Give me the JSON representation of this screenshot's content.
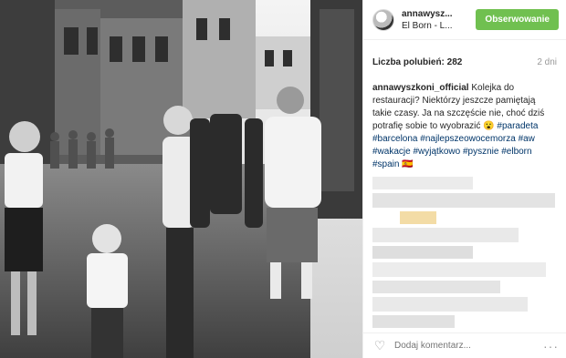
{
  "header": {
    "username": "annawysz...",
    "location": "El Born - L...",
    "follow_label": "Obserwowanie"
  },
  "meta": {
    "likes_label": "Liczba polubień: 282",
    "age": "2 dni"
  },
  "caption": {
    "user": "annawyszkoni_official",
    "text": " Kolejka do restauracji? Niektórzy jeszcze pamiętają takie czasy. Ja na szczęście nie, choć dziś potrafię sobie to wyobrazić 😮 ",
    "tags": [
      "#paradeta",
      "#barcelona",
      "#najlepszeowocemorza",
      "#aw",
      "#wakacje",
      "#wyjątkowo",
      "#pysznie",
      "#elborn",
      "#spain"
    ],
    "flag": "🇪🇸"
  },
  "footer": {
    "comment_placeholder": "Dodaj komentarz...",
    "more_label": "···"
  },
  "icons": {
    "like": "heart-icon",
    "more": "more-options-icon"
  },
  "colors": {
    "follow_button": "#70c050",
    "hashtag": "#003569"
  }
}
